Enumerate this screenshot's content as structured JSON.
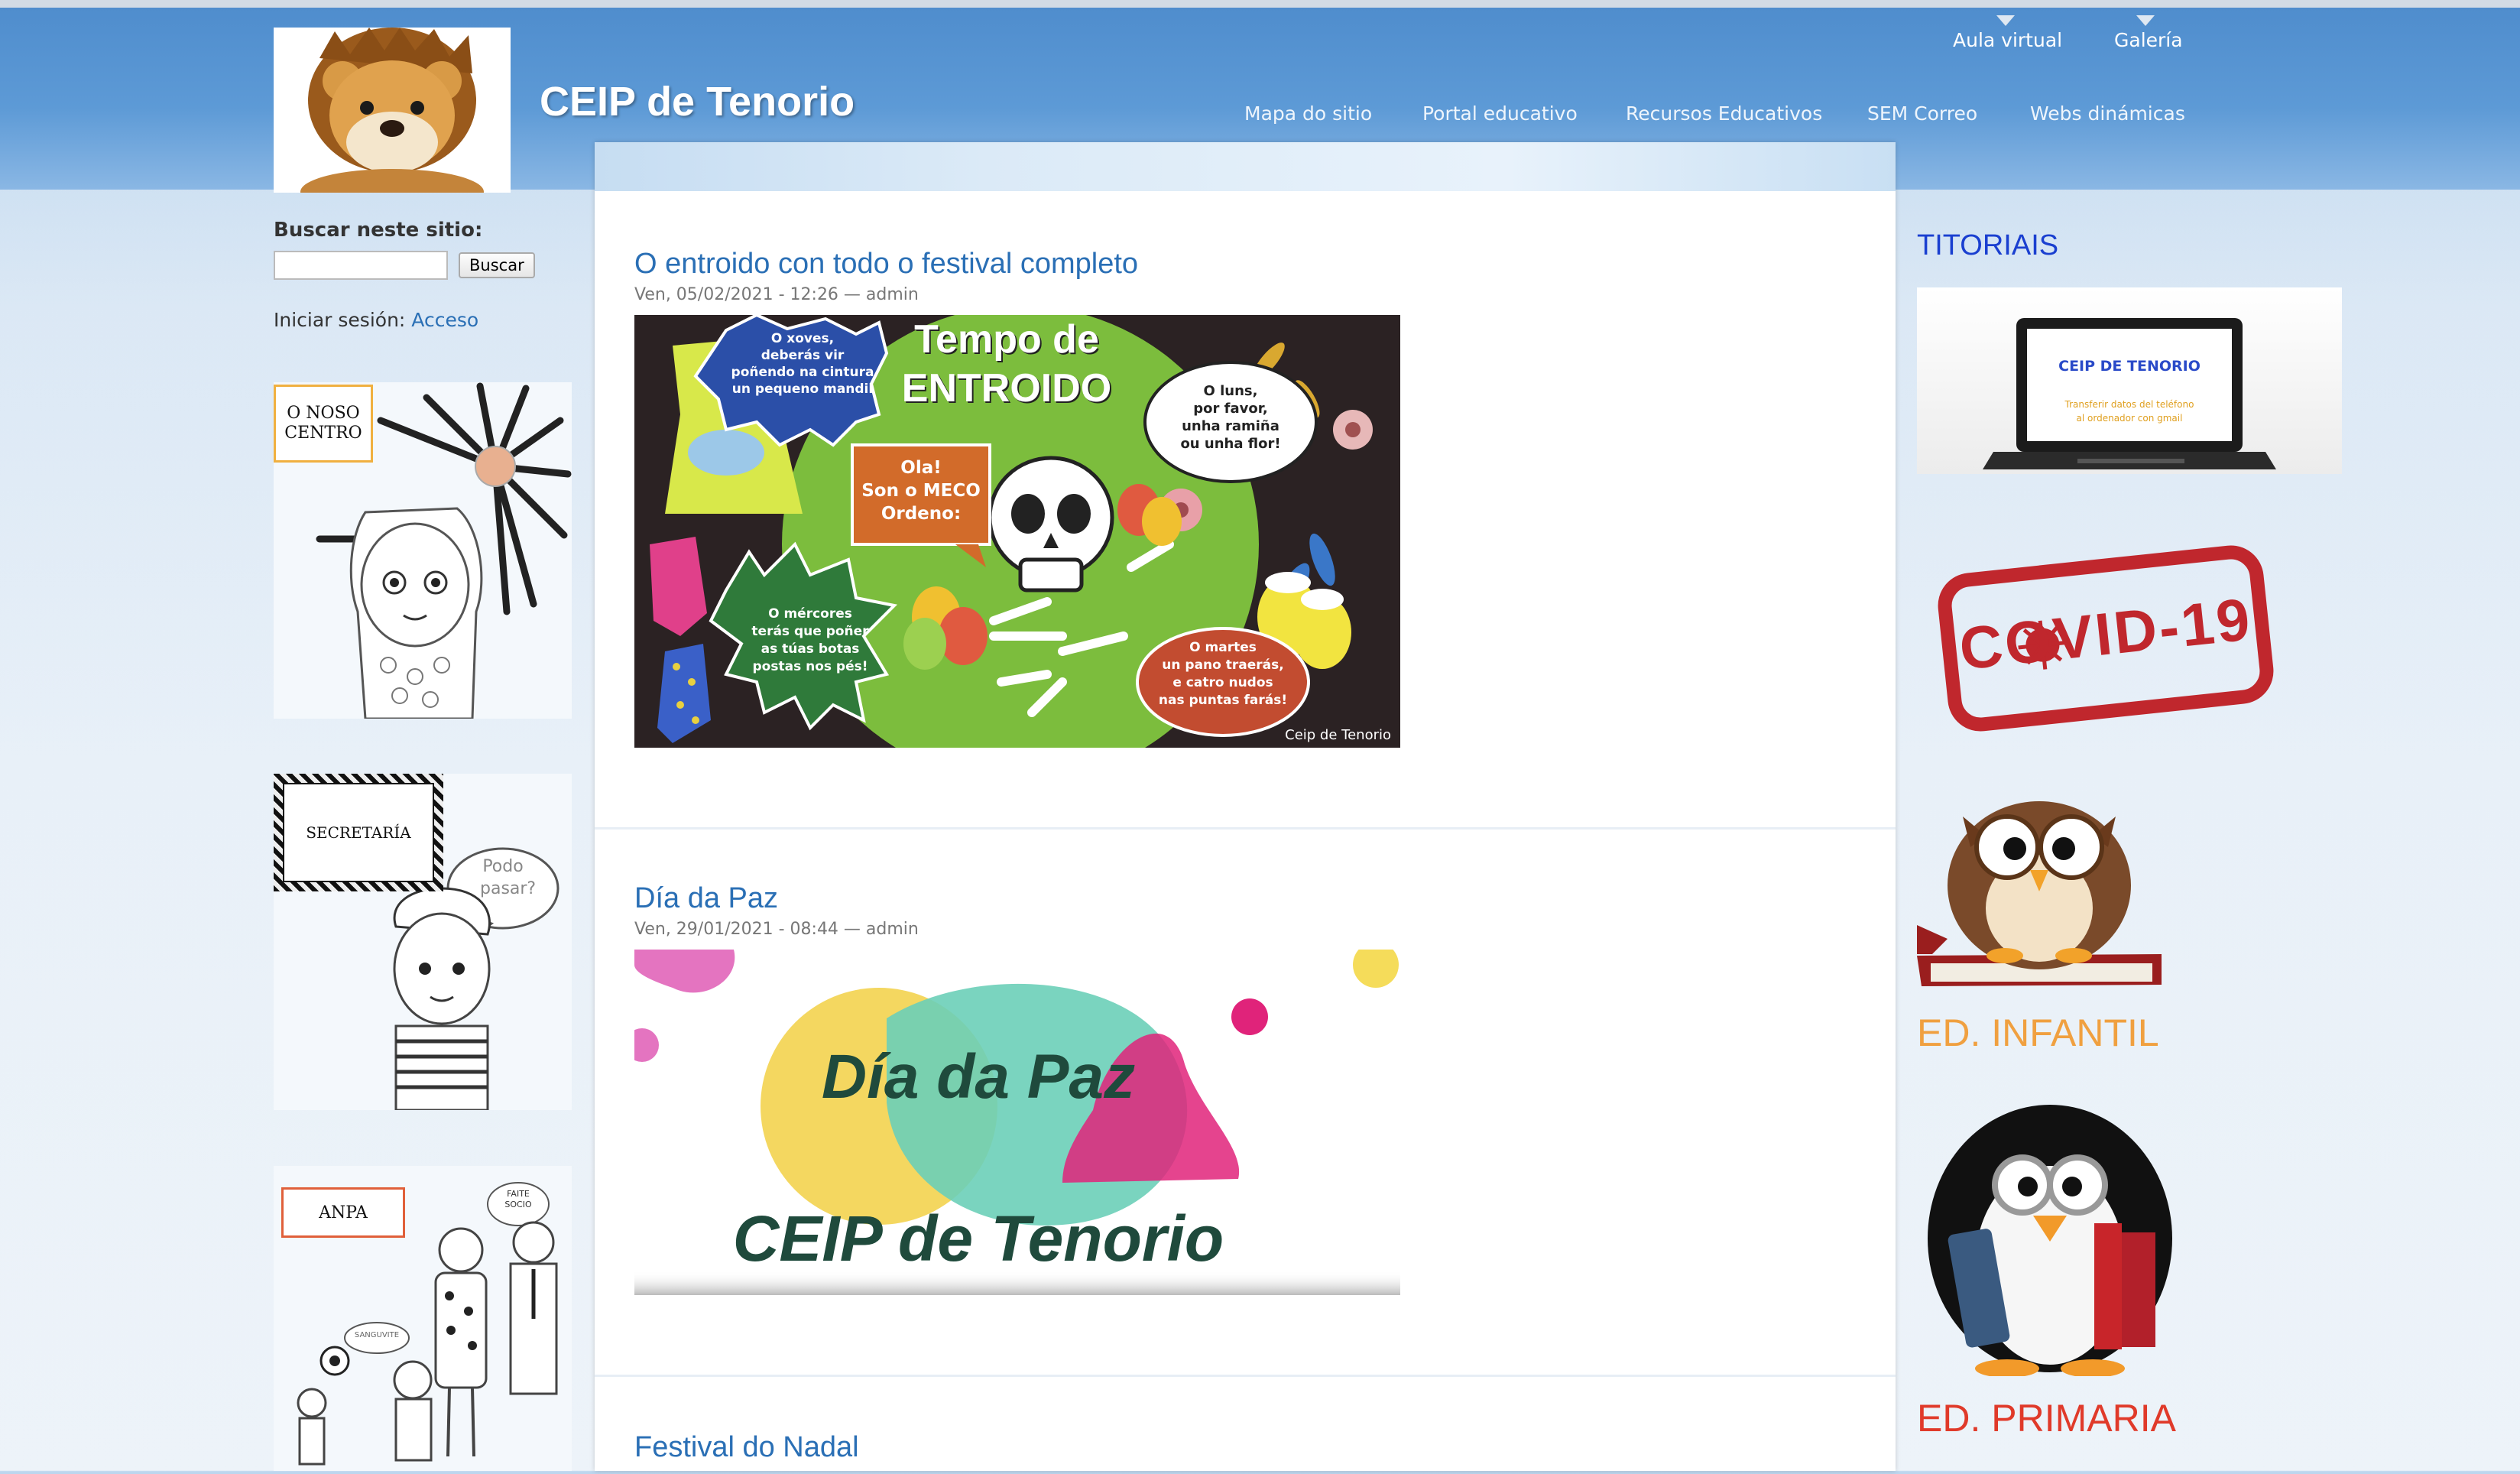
{
  "site": {
    "title": "CEIP de Tenorio"
  },
  "secondary_menu": [
    {
      "label": "Aula virtual"
    },
    {
      "label": "Galería"
    }
  ],
  "primary_menu": [
    {
      "label": "Mapa do sitio"
    },
    {
      "label": "Portal educativo"
    },
    {
      "label": "Recursos Educativos"
    },
    {
      "label": "SEM Correo"
    },
    {
      "label": "Webs dinámicas"
    }
  ],
  "search": {
    "label": "Buscar neste sitio:",
    "button": "Buscar",
    "value": ""
  },
  "login": {
    "prefix": "Iniciar sesión:",
    "link": "Acceso"
  },
  "left_blocks": [
    {
      "label": "O NOSO CENTRO",
      "line1": "O NOSO",
      "line2": "CENTRO"
    },
    {
      "label": "SECRETARÍA",
      "bubble1": "Podo",
      "bubble2": "pasar?"
    },
    {
      "label": "ANPA",
      "bubble1": "FAITE",
      "bubble2": "SOCIO",
      "bubble3": "SANGUVITE"
    }
  ],
  "posts": [
    {
      "title": "O entroido con todo o festival completo",
      "meta": "Ven, 05/02/2021 - 12:26 — admin",
      "image_text": {
        "heading1": "Tempo de",
        "heading2": "ENTROIDO",
        "t1a": "O xoves,",
        "t1b": "deberás vir",
        "t1c": "poñendo na cintura",
        "t1d": "un pequeno mandil",
        "t2a": "Ola!",
        "t2b": "Son o MECO",
        "t2c": "Ordeno:",
        "t3a": "O luns,",
        "t3b": "por favor,",
        "t3c": "unha ramiña",
        "t3d": "ou unha flor!",
        "t4a": "O mércores",
        "t4b": "terás que poñer",
        "t4c": "as túas botas",
        "t4d": "postas nos pés!",
        "t5a": "O martes",
        "t5b": "un pano traerás,",
        "t5c": "e catro nudos",
        "t5d": "nas puntas farás!",
        "credit": "Ceip de Tenorio"
      }
    },
    {
      "title": "Día da Paz",
      "meta": "Ven, 29/01/2021 - 08:44 — admin",
      "image_text": {
        "line1": "Día da Paz",
        "line2": "CEIP de Tenorio"
      }
    },
    {
      "title": "Festival do Nadal"
    }
  ],
  "right_sidebar": {
    "title": "TITORIAIS",
    "laptop_title": "CEIP DE TENORIO",
    "laptop_sub1": "Transferir datos del teléfono",
    "laptop_sub2": "al ordenador con gmail",
    "covid": "COVID-19",
    "infantil": "ED. INFANTIL",
    "primaria": "ED. PRIMARIA"
  },
  "colors": {
    "header_blue": "#5d9ad6",
    "link_blue": "#2a6fb5",
    "titoriais_blue": "#1a3fd0",
    "infantil_orange": "#f0a040",
    "primaria_red": "#e03a2a",
    "covid_red": "#c0272d"
  }
}
